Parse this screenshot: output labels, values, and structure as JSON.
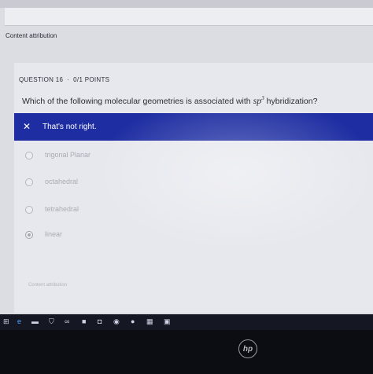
{
  "page": {
    "attribution_top": "Content attribution",
    "attribution_bottom": "Content attribution"
  },
  "question": {
    "number_label": "QUESTION 16",
    "separator": "·",
    "points": "0/1 POINTS",
    "text_before": "Which of the following molecular geometries is associated with ",
    "formula_base": "sp",
    "formula_sup": "3",
    "text_after": " hybridization?"
  },
  "feedback": {
    "icon": "x-icon",
    "message": "That's not right."
  },
  "options": [
    {
      "label": "trigonal Planar",
      "selected": false
    },
    {
      "label": "octahedral",
      "selected": false
    },
    {
      "label": "tetrahedral",
      "selected": false
    },
    {
      "label": "linear",
      "selected": true
    }
  ],
  "taskbar": {
    "icons": [
      "start-icon",
      "edge-icon",
      "mail-icon",
      "store-icon",
      "chat-icon",
      "files-icon",
      "chrome-icon",
      "app-icon",
      "photos-icon"
    ]
  },
  "colors": {
    "banner": "#1e2ea2",
    "screen_bg": "#dcdde3",
    "bezel": "#0c0d12"
  },
  "brand": {
    "logo": "hp"
  }
}
